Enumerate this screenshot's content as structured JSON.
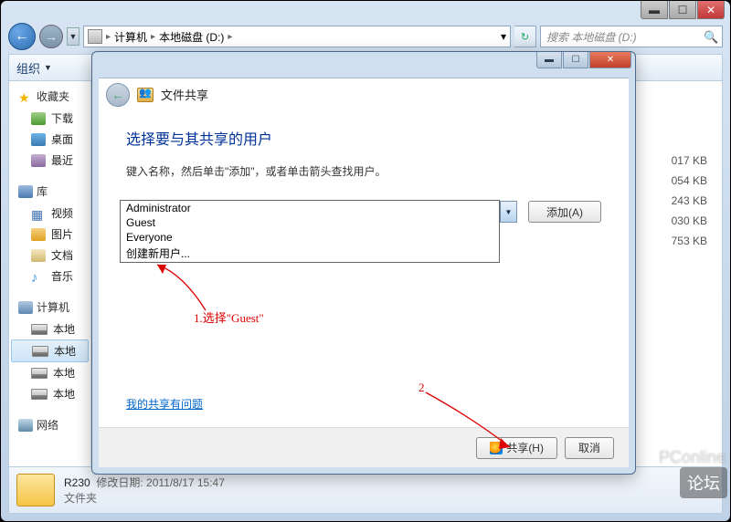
{
  "explorer": {
    "wincontrols": {
      "min": "▬",
      "max": "☐",
      "close": "✕"
    },
    "nav": {
      "back": "←",
      "fwd": "→",
      "drop": "▼",
      "path_seg1": "计算机",
      "path_seg2": "本地磁盘 (D:)",
      "sep": "▸",
      "dropdown_glyph": "▾",
      "refresh": "↻",
      "search_placeholder": "搜索 本地磁盘 (D:)",
      "search_icon": "🔍"
    },
    "toolbar": {
      "organize": "组织",
      "drop": "▼"
    },
    "sidebar": {
      "favorites": "收藏夹",
      "downloads": "下载",
      "desktop": "桌面",
      "recent": "最近",
      "libraries": "库",
      "videos": "视频",
      "pictures": "图片",
      "documents": "文档",
      "music": "音乐",
      "computer": "计算机",
      "local1": "本地",
      "local2": "本地",
      "local3": "本地",
      "local4": "本地",
      "network": "网络"
    },
    "filesizes": [
      "017 KB",
      "054 KB",
      "243 KB",
      "030 KB",
      "753 KB"
    ],
    "statusbar": {
      "name": "R230",
      "date_label": "修改日期:",
      "date": "2011/8/17 15:47",
      "type": "文件夹"
    }
  },
  "dialog": {
    "wincontrols": {
      "min": "▬",
      "max": "☐",
      "close": "✕"
    },
    "back_glyph": "←",
    "header_title": "文件共享",
    "title": "选择要与其共享的用户",
    "instruction": "键入名称，然后单击\"添加\"，或者单击箭头查找用户。",
    "combo_drop": "▼",
    "add_button": "添加(A)",
    "dropdown": {
      "opt1": "Administrator",
      "opt2": "Guest",
      "opt3": "Everyone",
      "opt4": "创建新用户..."
    },
    "help_link": "我的共享有问题",
    "share_button": "共享(H)",
    "cancel_button": "取消"
  },
  "annotations": {
    "step1": "1.选择\"Guest\"",
    "step2": "2"
  },
  "watermark": {
    "pconline": "PConline",
    "bbs": "论坛"
  }
}
